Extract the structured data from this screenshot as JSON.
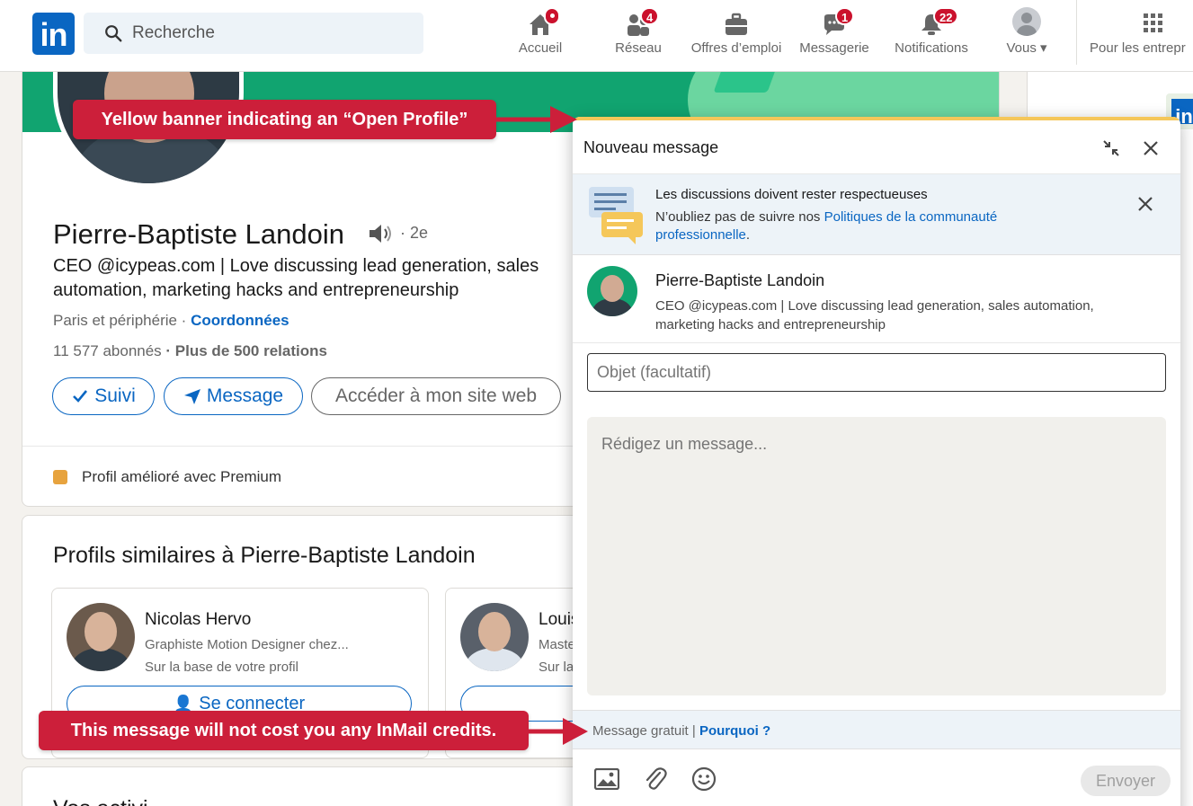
{
  "nav": {
    "search_placeholder": "Recherche",
    "items": [
      {
        "label": "Accueil",
        "icon": "home-icon",
        "badge": ""
      },
      {
        "label": "Réseau",
        "icon": "network-icon",
        "badge": "4"
      },
      {
        "label": "Offres d’emploi",
        "icon": "briefcase-icon",
        "badge": ""
      },
      {
        "label": "Messagerie",
        "icon": "messaging-icon",
        "badge": "1"
      },
      {
        "label": "Notifications",
        "icon": "bell-icon",
        "badge": "22"
      },
      {
        "label": "Vous",
        "icon": "me-avatar-icon",
        "badge": ""
      },
      {
        "label": "Pour les entrepr",
        "icon": "grid-icon",
        "badge": ""
      }
    ]
  },
  "profile": {
    "name": "Pierre-Baptiste Landoin",
    "degree": "· 2e",
    "headline": "CEO @icypeas.com | Love discussing lead generation, sales automation, marketing hacks and entrepreneurship",
    "location": "Paris et périphérie ·",
    "contact_link": "Coordonnées",
    "followers": "11 577 abonnés",
    "connections": "· Plus de 500 relations",
    "buttons": {
      "follow": "Suivi",
      "message": "Message",
      "website": "Accéder à mon site web"
    },
    "premium_note": "Profil amélioré avec Premium"
  },
  "similar": {
    "title": "Profils similaires à Pierre-Baptiste Landoin",
    "people": [
      {
        "name": "Nicolas Hervo",
        "headline": "Graphiste Motion Designer chez...",
        "reason": "Sur la base de votre profil",
        "button": "Se connecter"
      },
      {
        "name": "Louis",
        "headline": "Maste",
        "reason": "Sur la",
        "button": ""
      }
    ]
  },
  "next_section_title": "Vos activi",
  "dialog": {
    "title": "Nouveau message",
    "notice_title": "Les discussions doivent rester respectueuses",
    "notice_body_prefix": "N’oubliez pas de suivre nos ",
    "notice_link": "Politiques de la communauté professionnelle",
    "notice_body_suffix": ".",
    "recipient_name": "Pierre-Baptiste Landoin",
    "recipient_headline": "CEO @icypeas.com | Love discussing lead generation, sales automation, marketing hacks and entrepreneurship",
    "subject_placeholder": "Objet (facultatif)",
    "message_placeholder": "Rédigez un message...",
    "free_label": "Message gratuit | ",
    "free_link": "Pourquoi ?",
    "send_label": "Envoyer"
  },
  "annotations": {
    "top": "Yellow banner indicating an “Open Profile”",
    "bottom": "This message will not cost you any InMail credits."
  },
  "colors": {
    "brand": "#0a66c2",
    "badge": "#cb112d",
    "callout": "#cc1f3a",
    "open_profile_banner": "#f5c75a"
  }
}
